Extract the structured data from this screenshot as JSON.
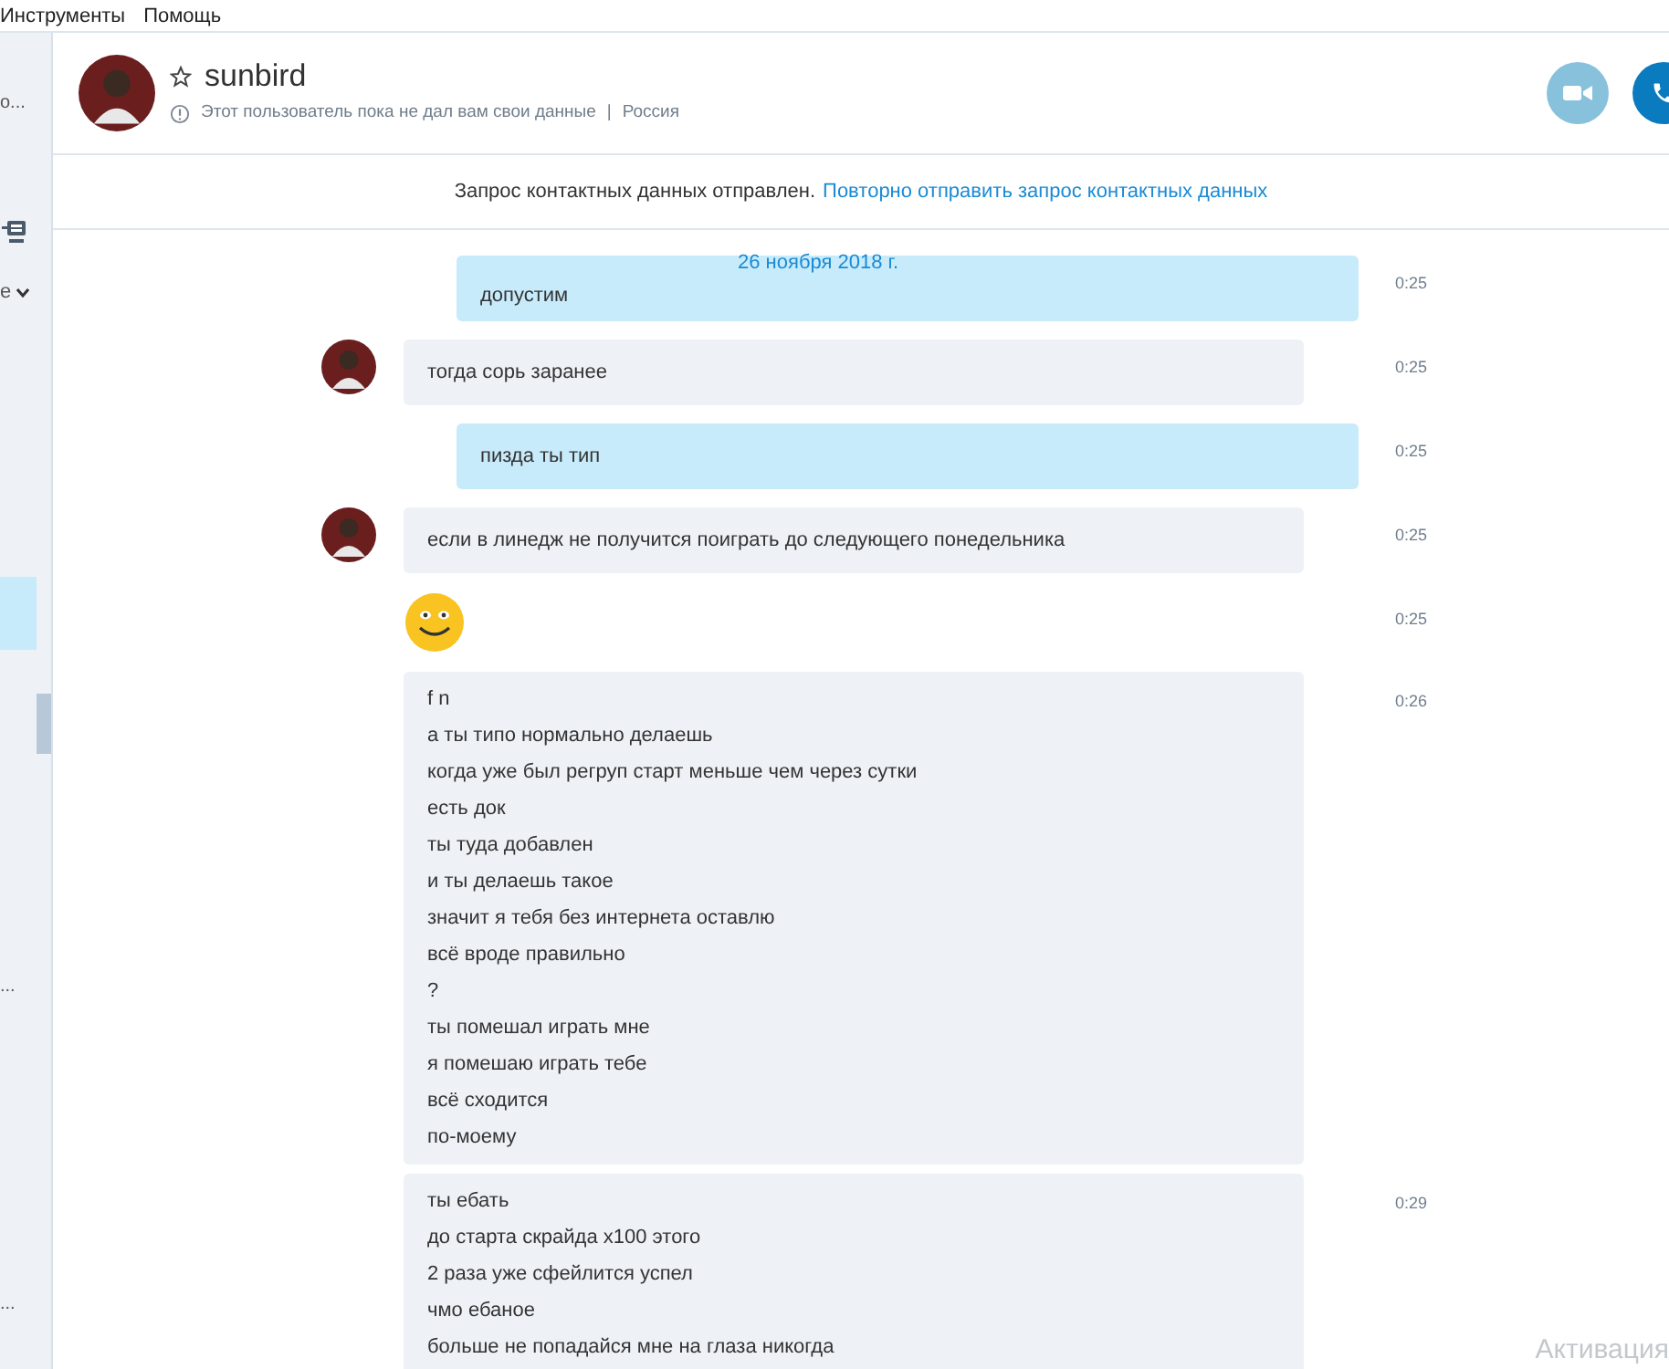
{
  "menu": [
    "Инструменты",
    "Помощь"
  ],
  "sidebar": {
    "items": [
      {
        "kind": "text",
        "label": "о..."
      },
      {
        "kind": "icon"
      },
      {
        "kind": "dropdown",
        "label": "е"
      },
      {
        "kind": "row",
        "selected": true
      },
      {
        "kind": "scrollbar"
      },
      {
        "kind": "text",
        "label": "..."
      },
      {
        "kind": "text",
        "label": "..."
      }
    ]
  },
  "contact": {
    "name": "sunbird",
    "favorite": false,
    "status": "Этот пользователь пока не дал вам свои данные",
    "separator": "|",
    "country": "Россия"
  },
  "call_buttons": [
    {
      "kind": "video",
      "disabled": true
    },
    {
      "kind": "call",
      "disabled": false
    }
  ],
  "notice": {
    "text": "Запрос контактных данных отправлен.",
    "link": "Повторно отправить запрос контактных данных"
  },
  "date_label": "26 ноября 2018 г.",
  "messages": [
    {
      "kind": "outgoing",
      "lines": [
        "допустим"
      ],
      "time": "0:25"
    },
    {
      "kind": "incoming",
      "avatar": true,
      "lines": [
        "тогда сорь заранее"
      ],
      "time": "0:25"
    },
    {
      "kind": "outgoing",
      "lines": [
        "пизда ты тип"
      ],
      "time": "0:25"
    },
    {
      "kind": "incoming",
      "avatar": true,
      "lines": [
        "если в линедж не получится поиграть до следующего понедельника"
      ],
      "time": "0:25"
    },
    {
      "kind": "emoji",
      "time": "0:25"
    },
    {
      "kind": "incoming",
      "lines": [
        "f n",
        "а ты типо нормально делаешь",
        "когда уже был регруп старт меньше чем через сутки",
        "есть док",
        "ты туда добавлен",
        "и ты делаешь такое",
        "значит я тебя без интернета оставлю",
        "всё вроде правильно",
        "?",
        "ты помешал играть мне",
        "я помешаю играть тебе",
        "всё сходится",
        "по-моему"
      ],
      "time": "0:26"
    },
    {
      "kind": "incoming",
      "lines": [
        "ты ебать",
        "до старта скрайда х100 этого",
        "2 раза уже сфейлится успел",
        "чмо ебаное",
        "больше не попадайся мне на глаза никогда"
      ],
      "time": "0:29"
    }
  ],
  "os_watermark": "Активация"
}
